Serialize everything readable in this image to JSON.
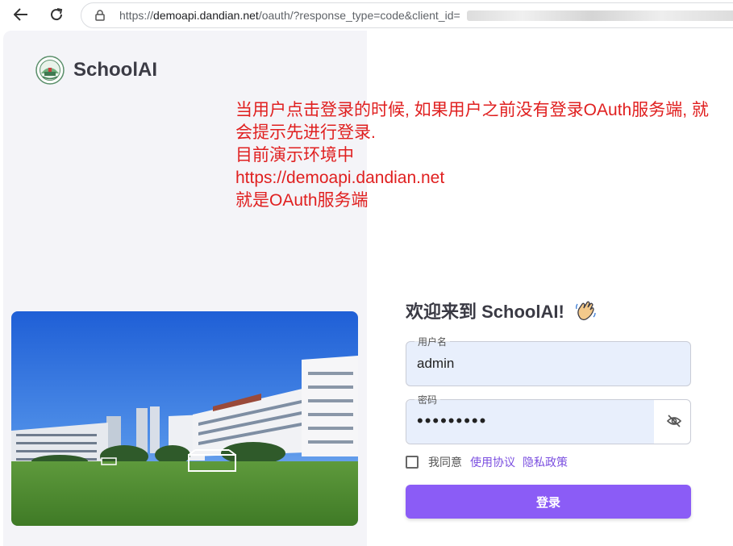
{
  "browser": {
    "url_prefix": "https://",
    "url_host": "demoapi.dandian.net",
    "url_path": "/oauth/?response_type=code&client_id="
  },
  "brand": {
    "name": "SchoolAI"
  },
  "annotation": {
    "lines": [
      "当用户点击登录的时候, 如果用户之前没有登录OAuth服务端, 就",
      "会提示先进行登录.",
      "目前演示环境中",
      "https://demoapi.dandian.net",
      "就是OAuth服务端"
    ],
    "color": "#e02020"
  },
  "login": {
    "welcome": "欢迎来到 SchoolAI!",
    "username_label": "用户名",
    "username_value": "admin",
    "password_label": "密码",
    "password_mask": "•••••••••",
    "agree_text": "我同意",
    "terms_link": "使用协议",
    "privacy_link": "隐私政策",
    "submit_label": "登录"
  },
  "colors": {
    "accent": "#8b5cf6",
    "link": "#7b4fe0",
    "input_fill": "#e8effc",
    "left_panel_bg": "#f4f4f8"
  }
}
